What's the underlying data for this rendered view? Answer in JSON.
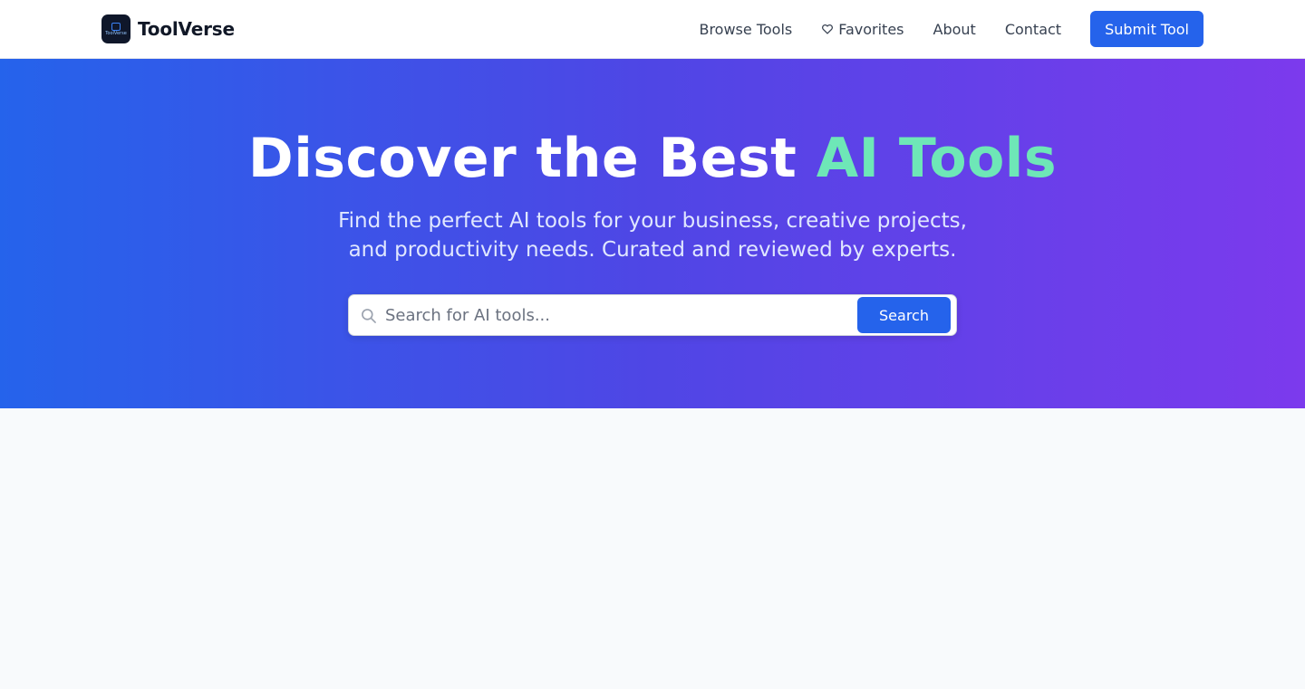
{
  "brand": {
    "name": "ToolVerse",
    "logo_text": "ToolVerse"
  },
  "nav": {
    "links": [
      {
        "label": "Browse Tools"
      },
      {
        "label": "Favorites",
        "icon": "heart-icon"
      },
      {
        "label": "About"
      },
      {
        "label": "Contact"
      }
    ],
    "submit_label": "Submit Tool"
  },
  "hero": {
    "title_main": "Discover the Best ",
    "title_accent": "AI Tools",
    "subtitle_line1": "Find the perfect AI tools for your business, creative projects,",
    "subtitle_line2": "and productivity needs. Curated and reviewed by experts."
  },
  "search": {
    "placeholder": "Search for AI tools...",
    "value": "",
    "button_label": "Search",
    "icon": "search-icon"
  },
  "colors": {
    "primary": "#2563eb",
    "gradient_start": "#2563eb",
    "gradient_end": "#7c3aed",
    "accent": "#6ee7b7"
  }
}
